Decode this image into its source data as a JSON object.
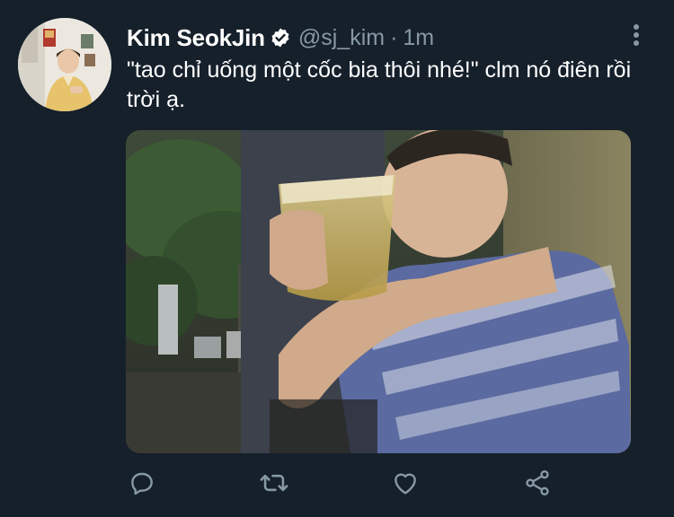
{
  "tweet": {
    "author_name": "Kim SeokJin",
    "handle": "@sj_kim",
    "separator": "·",
    "time": "1m",
    "text": "\"tao chỉ uống một cốc bia thôi nhé!\" clm nó điên rồi trời ạ."
  },
  "icons": {
    "verified": "verified-badge-icon",
    "more": "more-vertical-icon",
    "reply": "reply-icon",
    "retweet": "retweet-icon",
    "like": "heart-icon",
    "share": "share-icon"
  },
  "colors": {
    "background": "#15202b",
    "text_primary": "#ffffff",
    "text_secondary": "#8899a6"
  }
}
